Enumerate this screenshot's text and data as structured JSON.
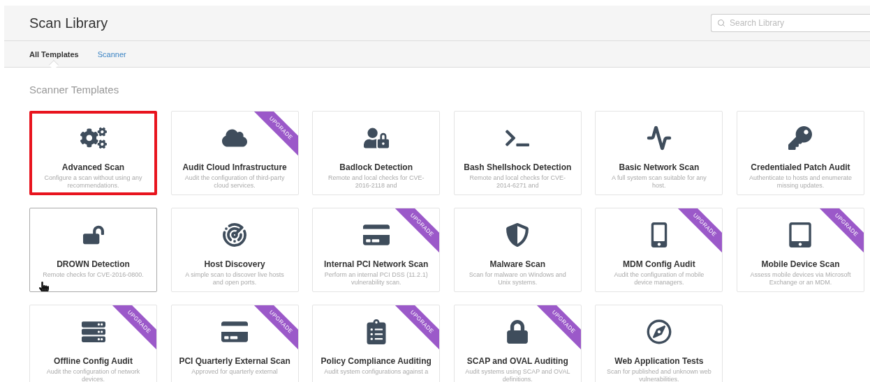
{
  "header": {
    "title": "Scan Library",
    "search": {
      "placeholder": "Search Library"
    }
  },
  "tabs": [
    {
      "label": "All Templates",
      "selected": true
    },
    {
      "label": "Scanner",
      "selected": false
    }
  ],
  "section_title": "Scanner Templates",
  "templates": [
    {
      "title": "Advanced Scan",
      "description": "Configure a scan without using any recommendations.",
      "highlighted": true,
      "hovered": false
    },
    {
      "title": "Audit Cloud Infrastructure",
      "description": "Audit the configuration of third-party cloud services.",
      "badge": "UPGRADE",
      "highlighted": false,
      "hovered": false
    },
    {
      "title": "Badlock Detection",
      "description": "Remote and local checks for CVE-2016-2118 and",
      "highlighted": false,
      "hovered": false
    },
    {
      "title": "Bash Shellshock Detection",
      "description": "Remote and local checks for CVE-2014-6271 and",
      "highlighted": false,
      "hovered": false
    },
    {
      "title": "Basic Network Scan",
      "description": "A full system scan suitable for any host.",
      "highlighted": false,
      "hovered": false
    },
    {
      "title": "Credentialed Patch Audit",
      "description": "Authenticate to hosts and enumerate missing updates.",
      "highlighted": false,
      "hovered": false
    },
    {
      "title": "DROWN Detection",
      "description": "Remote checks for CVE-2016-0800.",
      "highlighted": false,
      "hovered": true
    },
    {
      "title": "Host Discovery",
      "description": "A simple scan to discover live hosts and open ports.",
      "highlighted": false,
      "hovered": false
    },
    {
      "title": "Internal PCI Network Scan",
      "description": "Perform an internal PCI DSS (11.2.1) vulnerability scan.",
      "badge": "UPGRADE",
      "highlighted": false,
      "hovered": false
    },
    {
      "title": "Malware Scan",
      "description": "Scan for malware on Windows and Unix systems.",
      "highlighted": false,
      "hovered": false
    },
    {
      "title": "MDM Config Audit",
      "description": "Audit the configuration of mobile device managers.",
      "badge": "UPGRADE",
      "highlighted": false,
      "hovered": false
    },
    {
      "title": "Mobile Device Scan",
      "description": "Assess mobile devices via Microsoft Exchange or an MDM.",
      "badge": "UPGRADE",
      "highlighted": false,
      "hovered": false
    },
    {
      "title": "Offline Config Audit",
      "description": "Audit the configuration of network devices.",
      "badge": "UPGRADE",
      "highlighted": false,
      "hovered": false
    },
    {
      "title": "PCI Quarterly External Scan",
      "description": "Approved for quarterly external",
      "badge": "UPGRADE",
      "highlighted": false,
      "hovered": false
    },
    {
      "title": "Policy Compliance Auditing",
      "description": "Audit system configurations against a",
      "badge": "UPGRADE",
      "highlighted": false,
      "hovered": false
    },
    {
      "title": "SCAP and OVAL Auditing",
      "description": "Audit systems using SCAP and OVAL definitions.",
      "badge": "UPGRADE",
      "highlighted": false,
      "hovered": false
    },
    {
      "title": "Web Application Tests",
      "description": "Scan for published and unknown web vulnerabilities.",
      "highlighted": false,
      "hovered": false
    }
  ]
}
